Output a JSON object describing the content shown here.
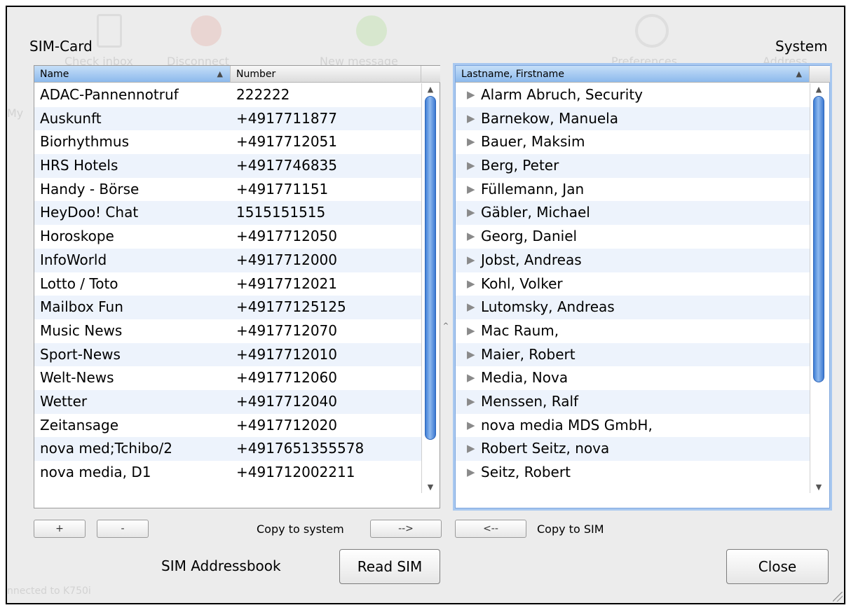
{
  "dialog": {
    "sim_label": "SIM-Card",
    "system_label": "System",
    "sim_addressbook_label": "SIM Addressbook",
    "copy_to_system_label": "Copy to system",
    "copy_to_sim_label": "Copy to SIM"
  },
  "background_app": {
    "toolbar_items": [
      "Check inbox",
      "Disconnect",
      "New message",
      "Preferences",
      "Address"
    ],
    "status": "nnected to K750i",
    "side_label": "My"
  },
  "sim_table": {
    "columns": [
      "Name",
      "Number"
    ],
    "rows": [
      {
        "name": "ADAC-Pannennotruf",
        "number": "222222"
      },
      {
        "name": "Auskunft",
        "number": "+4917711877"
      },
      {
        "name": "Biorhythmus",
        "number": "+4917712051"
      },
      {
        "name": "HRS Hotels",
        "number": "+4917746835"
      },
      {
        "name": "Handy - Börse",
        "number": "+491771151"
      },
      {
        "name": "HeyDoo! Chat",
        "number": "1515151515"
      },
      {
        "name": "Horoskope",
        "number": "+4917712050"
      },
      {
        "name": "InfoWorld",
        "number": "+4917712000"
      },
      {
        "name": "Lotto / Toto",
        "number": "+4917712021"
      },
      {
        "name": "Mailbox Fun",
        "number": "+49177125125"
      },
      {
        "name": "Music News",
        "number": "+4917712070"
      },
      {
        "name": "Sport-News",
        "number": "+4917712010"
      },
      {
        "name": "Welt-News",
        "number": "+4917712060"
      },
      {
        "name": "Wetter",
        "number": "+4917712040"
      },
      {
        "name": "Zeitansage",
        "number": "+4917712020"
      },
      {
        "name": "nova med;Tchibo/2",
        "number": "+4917651355578"
      },
      {
        "name": "nova media, D1",
        "number": "+491712002211"
      }
    ]
  },
  "system_table": {
    "column": "Lastname, Firstname",
    "rows": [
      "Alarm Abruch, Security",
      "Barnekow, Manuela",
      "Bauer, Maksim",
      "Berg, Peter",
      "Füllemann, Jan",
      "Gäbler, Michael",
      "Georg, Daniel",
      "Jobst, Andreas",
      "Kohl, Volker",
      "Lutomsky, Andreas",
      "Mac Raum,",
      "Maier, Robert",
      "Media, Nova",
      "Menssen, Ralf",
      "nova media MDS GmbH,",
      "Robert Seitz, nova",
      "Seitz, Robert"
    ]
  },
  "buttons": {
    "add": "+",
    "remove": "-",
    "copy_to_system": "-->",
    "copy_to_sim": "<--",
    "read_sim": "Read SIM",
    "close": "Close"
  },
  "scroll": {
    "sim_thumb_fraction": 0.9,
    "system_thumb_fraction": 0.75
  }
}
